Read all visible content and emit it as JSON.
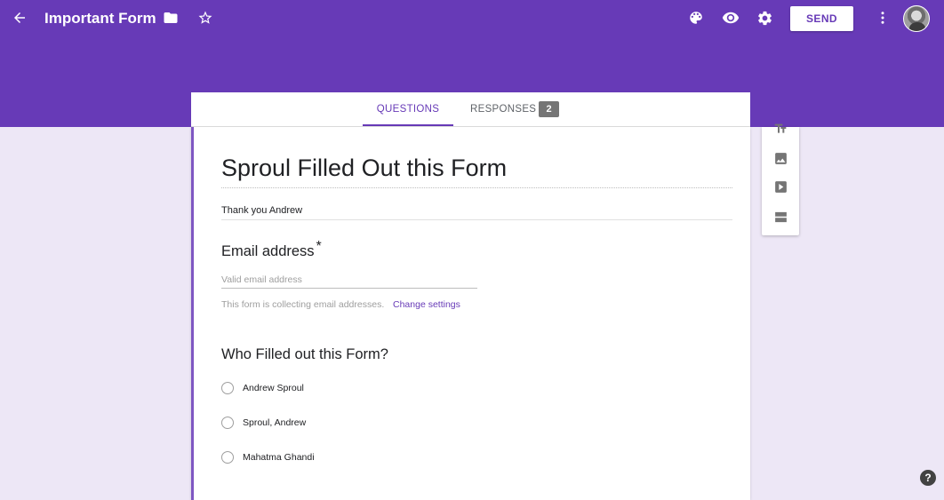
{
  "app": {
    "title": "Important Form",
    "send_label": "SEND"
  },
  "icons": {
    "back": "arrow-left",
    "folder": "folder",
    "star": "star-outline",
    "palette": "palette",
    "preview": "eye",
    "settings": "gear",
    "more": "vertical-dots",
    "help": "question-circle"
  },
  "tabs": [
    {
      "label": "QUESTIONS",
      "active": true
    },
    {
      "label": "RESPONSES",
      "active": false,
      "badge": "2"
    }
  ],
  "form": {
    "title": "Sproul Filled Out this Form",
    "description": "Thank you Andrew",
    "email_question": {
      "label": "Email address",
      "required_mark": "*",
      "placeholder": "Valid email address",
      "note": "This form is collecting email addresses.",
      "link": "Change settings"
    },
    "question2": {
      "label": "Who Filled out this Form?",
      "options": [
        "Andrew Sproul",
        "Sproul, Andrew",
        "Mahatma Ghandi"
      ]
    }
  },
  "toolbar": {
    "items": [
      "add-title-icon",
      "add-image-icon",
      "add-video-icon",
      "add-section-icon"
    ]
  },
  "help": {
    "glyph": "?"
  },
  "colors": {
    "theme": "#673ab7",
    "background": "#ede7f6",
    "accent_border": "#7e57c2"
  }
}
